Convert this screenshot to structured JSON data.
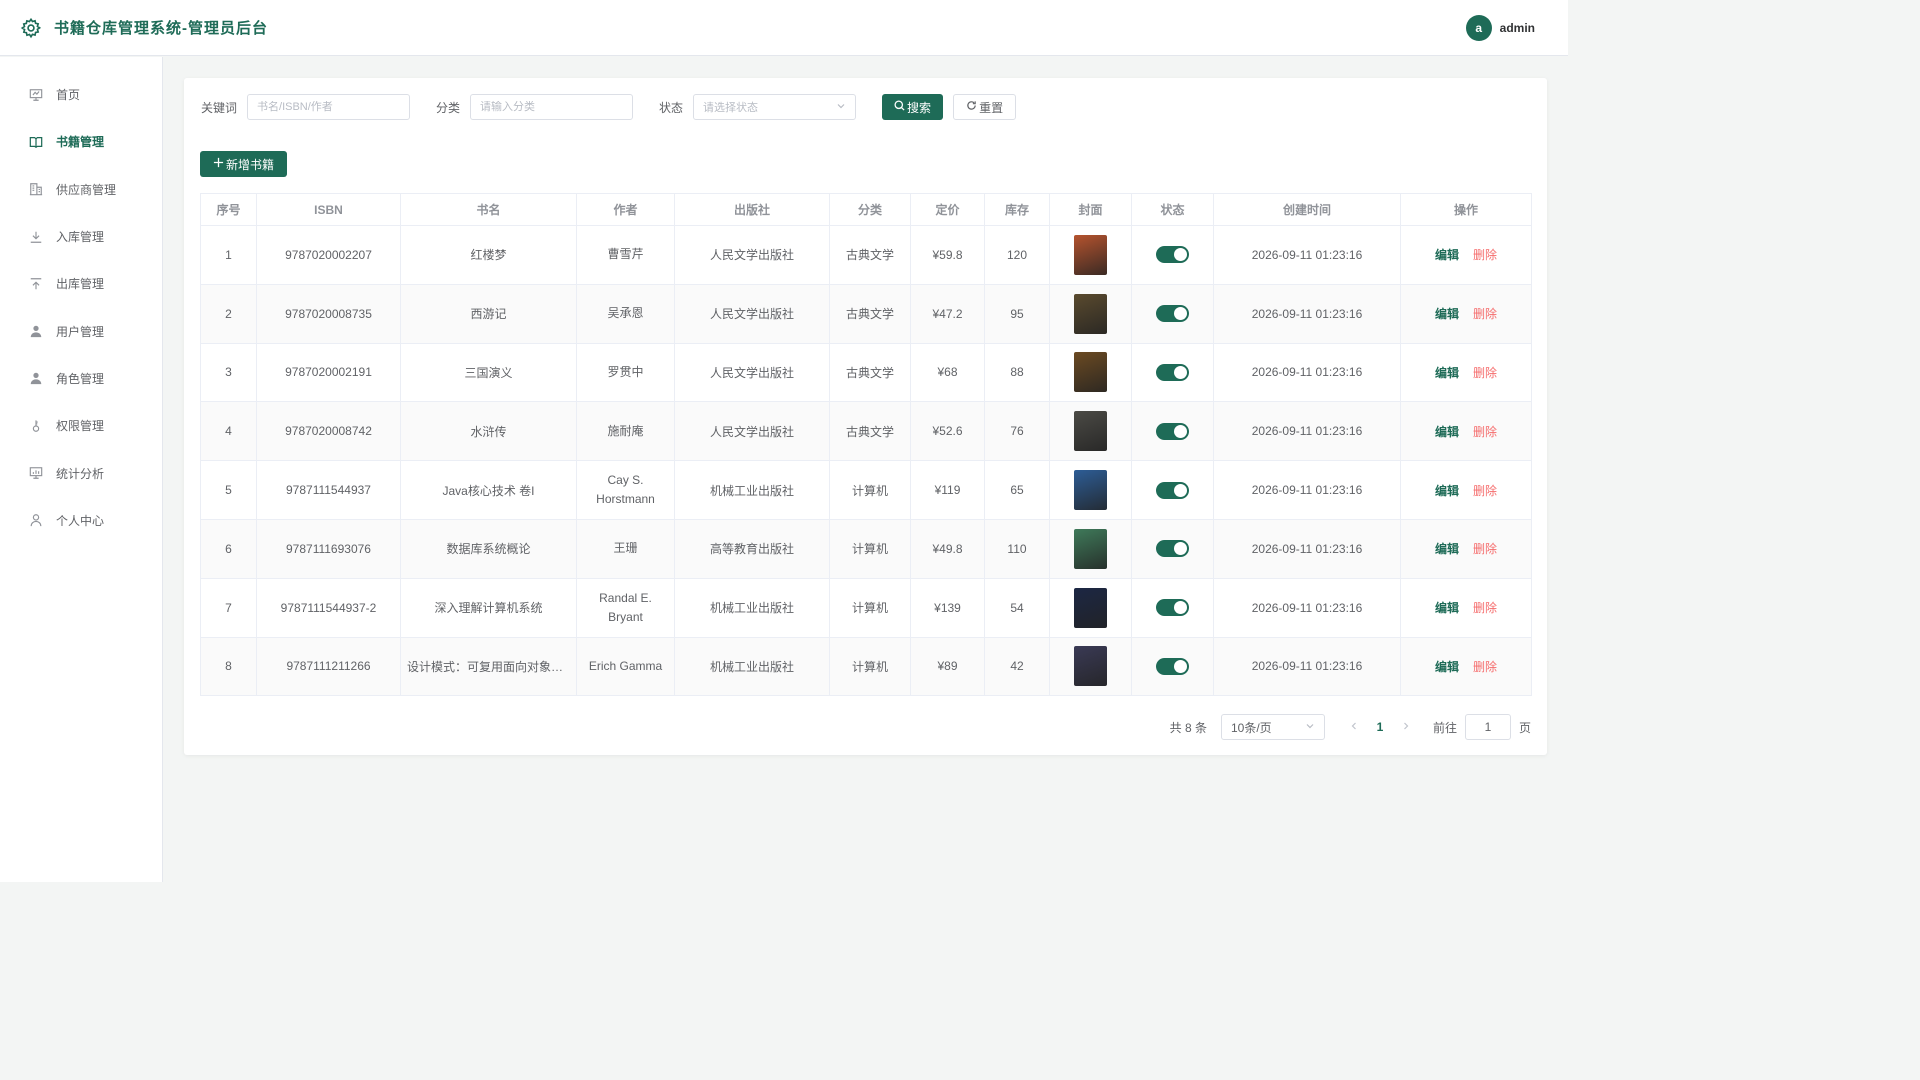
{
  "header": {
    "title": "书籍仓库管理系统-管理员后台",
    "avatar_letter": "a",
    "username": "admin"
  },
  "sidebar": {
    "items": [
      {
        "label": "首页",
        "icon": "dashboard-icon"
      },
      {
        "label": "书籍管理",
        "icon": "book-icon",
        "active": true
      },
      {
        "label": "供应商管理",
        "icon": "building-icon"
      },
      {
        "label": "入库管理",
        "icon": "download-icon"
      },
      {
        "label": "出库管理",
        "icon": "upload-icon"
      },
      {
        "label": "用户管理",
        "icon": "user-icon"
      },
      {
        "label": "角色管理",
        "icon": "user-role-icon"
      },
      {
        "label": "权限管理",
        "icon": "key-icon"
      },
      {
        "label": "统计分析",
        "icon": "chart-icon"
      },
      {
        "label": "个人中心",
        "icon": "profile-icon"
      }
    ]
  },
  "filters": {
    "keyword_label": "关键词",
    "keyword_placeholder": "书名/ISBN/作者",
    "category_label": "分类",
    "category_placeholder": "请输入分类",
    "status_label": "状态",
    "status_placeholder": "请选择状态",
    "search_button": "搜索",
    "reset_button": "重置"
  },
  "add_button": "新增书籍",
  "table": {
    "columns": [
      "序号",
      "ISBN",
      "书名",
      "作者",
      "出版社",
      "分类",
      "定价",
      "库存",
      "封面",
      "状态",
      "创建时间",
      "操作"
    ],
    "edit_label": "编辑",
    "delete_label": "删除",
    "rows": [
      {
        "no": "1",
        "isbn": "9787020002207",
        "title": "红楼梦",
        "author": "曹雪芹",
        "publisher": "人民文学出版社",
        "category": "古典文学",
        "price": "¥59.8",
        "stock": "120",
        "status": true,
        "created": "2026-09-11 01:23:16",
        "cover_color": "#b5532e"
      },
      {
        "no": "2",
        "isbn": "9787020008735",
        "title": "西游记",
        "author": "吴承恩",
        "publisher": "人民文学出版社",
        "category": "古典文学",
        "price": "¥47.2",
        "stock": "95",
        "status": true,
        "created": "2026-09-11 01:23:16",
        "cover_color": "#5a4a2e"
      },
      {
        "no": "3",
        "isbn": "9787020002191",
        "title": "三国演义",
        "author": "罗贯中",
        "publisher": "人民文学出版社",
        "category": "古典文学",
        "price": "¥68",
        "stock": "88",
        "status": true,
        "created": "2026-09-11 01:23:16",
        "cover_color": "#6b4a22"
      },
      {
        "no": "4",
        "isbn": "9787020008742",
        "title": "水浒传",
        "author": "施耐庵",
        "publisher": "人民文学出版社",
        "category": "古典文学",
        "price": "¥52.6",
        "stock": "76",
        "status": true,
        "created": "2026-09-11 01:23:16",
        "cover_color": "#4b4a45"
      },
      {
        "no": "5",
        "isbn": "9787111544937",
        "title": "Java核心技术 卷I",
        "author": "Cay S. Horstmann",
        "publisher": "机械工业出版社",
        "category": "计算机",
        "price": "¥119",
        "stock": "65",
        "status": true,
        "created": "2026-09-11 01:23:16",
        "cover_color": "#2d5d96"
      },
      {
        "no": "6",
        "isbn": "9787111693076",
        "title": "数据库系统概论",
        "author": "王珊",
        "publisher": "高等教育出版社",
        "category": "计算机",
        "price": "¥49.8",
        "stock": "110",
        "status": true,
        "created": "2026-09-11 01:23:16",
        "cover_color": "#3f7a5a"
      },
      {
        "no": "7",
        "isbn": "9787111544937-2",
        "title": "深入理解计算机系统",
        "author": "Randal E. Bryant",
        "publisher": "机械工业出版社",
        "category": "计算机",
        "price": "¥139",
        "stock": "54",
        "status": true,
        "created": "2026-09-11 01:23:16",
        "cover_color": "#1c2744"
      },
      {
        "no": "8",
        "isbn": "9787111211266",
        "title": "设计模式：可复用面向对象软件的基础",
        "author": "Erich Gamma",
        "publisher": "机械工业出版社",
        "category": "计算机",
        "price": "¥89",
        "stock": "42",
        "status": true,
        "created": "2026-09-11 01:23:16",
        "cover_color": "#3a3a55"
      }
    ]
  },
  "pagination": {
    "total_text": "共 8 条",
    "page_size": "10条/页",
    "current_page": "1",
    "goto_label": "前往",
    "goto_value": "1",
    "page_suffix": "页"
  },
  "colors": {
    "primary": "#1e6b57",
    "danger": "#f56c6c"
  }
}
